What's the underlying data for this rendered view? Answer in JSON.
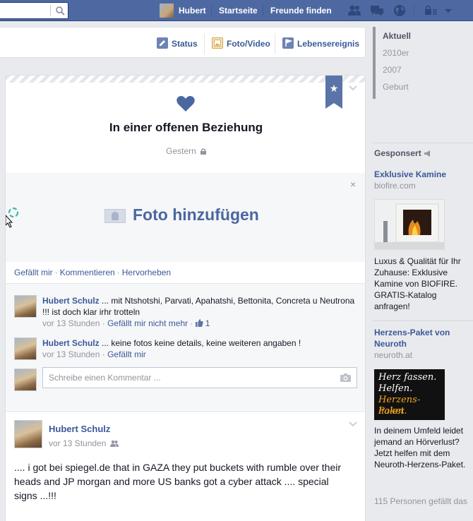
{
  "topbar": {
    "user_name": "Hubert",
    "home_label": "Startseite",
    "find_friends_label": "Freunde finden"
  },
  "composer": {
    "status_label": "Status",
    "photo_video_label": "Foto/Video",
    "life_event_label": "Lebensereignis"
  },
  "event": {
    "title": "In einer offenen Beziehung",
    "date": "Gestern",
    "add_photo_label": "Foto hinzufügen",
    "close_symbol": "×",
    "bookmark_symbol": "★",
    "actions": {
      "like": "Gefällt mir",
      "comment": "Kommentieren",
      "highlight": "Hervorheben",
      "separator": "·"
    },
    "comments": [
      {
        "author": "Hubert Schulz",
        "text": "... mit Ntshotshi, Parvati, Apahatshi, Bettonita, Concreta u Neutrona !!! ist doch klar irhr trotteln",
        "time": "vor 13 Stunden",
        "action": "Gefällt mir nicht mehr",
        "likes": "1"
      },
      {
        "author": "Hubert Schulz",
        "text": "... keine fotos keine details, keine weiteren angaben !",
        "time": "vor 13 Stunden",
        "action": "Gefällt mir"
      }
    ],
    "comment_placeholder": "Schreibe einen Kommentar ..."
  },
  "post": {
    "author": "Hubert Schulz",
    "time": "vor 13 Stunden",
    "text": ".... i got bei spiegel.de that in GAZA they put buckets with rumble over their heads and JP morgan and more US banks got a cyber attack .... special signs ...!!!"
  },
  "timeline_nav": {
    "items": [
      "Aktuell",
      "2010er",
      "2007",
      "Geburt"
    ]
  },
  "sponsored": {
    "heading": "Gesponsert",
    "ads": [
      {
        "title": "Exklusive Kamine",
        "domain": "biofire.com",
        "text": "Luxus & Qualität für Ihr Zuhause: Exklusive Kamine von BIOFIRE. GRATIS-Katalog anfragen!"
      },
      {
        "title": "Herzens-Paket von Neuroth",
        "domain": "neuroth.at",
        "image_lines": [
          "Herz fassen.",
          "Helfen.",
          "Herzens-Paket",
          "holen."
        ],
        "text": "In deinem Umfeld leidet jemand an Hörverlust? Jetzt helfen mit dem Neuroth-Herzens-Paket.",
        "likes": "115 Personen gefällt das"
      }
    ]
  },
  "colors": {
    "topbar": "#4e69a2",
    "link": "#3b5998",
    "accent_heart": "#4b67a1"
  }
}
